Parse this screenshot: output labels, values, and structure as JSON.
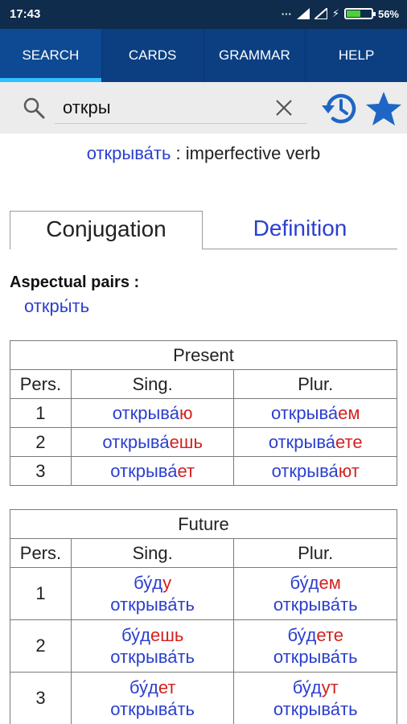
{
  "status": {
    "time": "17:43",
    "battery": "56%",
    "battery_level": 0.56
  },
  "tabs": [
    {
      "label": "SEARCH",
      "active": true
    },
    {
      "label": "CARDS",
      "active": false
    },
    {
      "label": "GRAMMAR",
      "active": false
    },
    {
      "label": "HELP",
      "active": false
    }
  ],
  "search": {
    "value": "откры"
  },
  "word": {
    "lemma": "открыва́ть",
    "separator": ":",
    "pos": "imperfective verb"
  },
  "segments": {
    "conjugation": "Conjugation",
    "definition": "Definition"
  },
  "aspect": {
    "label": "Aspectual pairs :",
    "pair": "откры́ть"
  },
  "present": {
    "title": "Present",
    "headers": [
      "Pers.",
      "Sing.",
      "Plur."
    ],
    "rows": [
      {
        "pers": "1",
        "sing_stem": "открыва́",
        "sing_end": "ю",
        "plur_stem": "открыва́",
        "plur_end": "ем"
      },
      {
        "pers": "2",
        "sing_stem": "открыва́",
        "sing_end": "ешь",
        "plur_stem": "открыва́",
        "plur_end": "ете"
      },
      {
        "pers": "3",
        "sing_stem": "открыва́",
        "sing_end": "ет",
        "plur_stem": "открыва́",
        "plur_end": "ют"
      }
    ]
  },
  "future": {
    "title": "Future",
    "headers": [
      "Pers.",
      "Sing.",
      "Plur."
    ],
    "infinitive": "открыва́ть",
    "rows": [
      {
        "pers": "1",
        "sing_stem": "бу́д",
        "sing_end": "у",
        "plur_stem": "бу́д",
        "plur_end": "ем"
      },
      {
        "pers": "2",
        "sing_stem": "бу́д",
        "sing_end": "ешь",
        "plur_stem": "бу́д",
        "plur_end": "ете"
      },
      {
        "pers": "3",
        "sing_stem": "бу́д",
        "sing_end": "ет",
        "plur_stem": "бу́д",
        "plur_end": "ут"
      }
    ]
  },
  "colors": {
    "accent_blue": "#2b3fcf",
    "ending_red": "#d42020",
    "tab_bar": "#0b3f82",
    "tab_indicator": "#2ec0ff",
    "status_bar": "#102c4c"
  }
}
